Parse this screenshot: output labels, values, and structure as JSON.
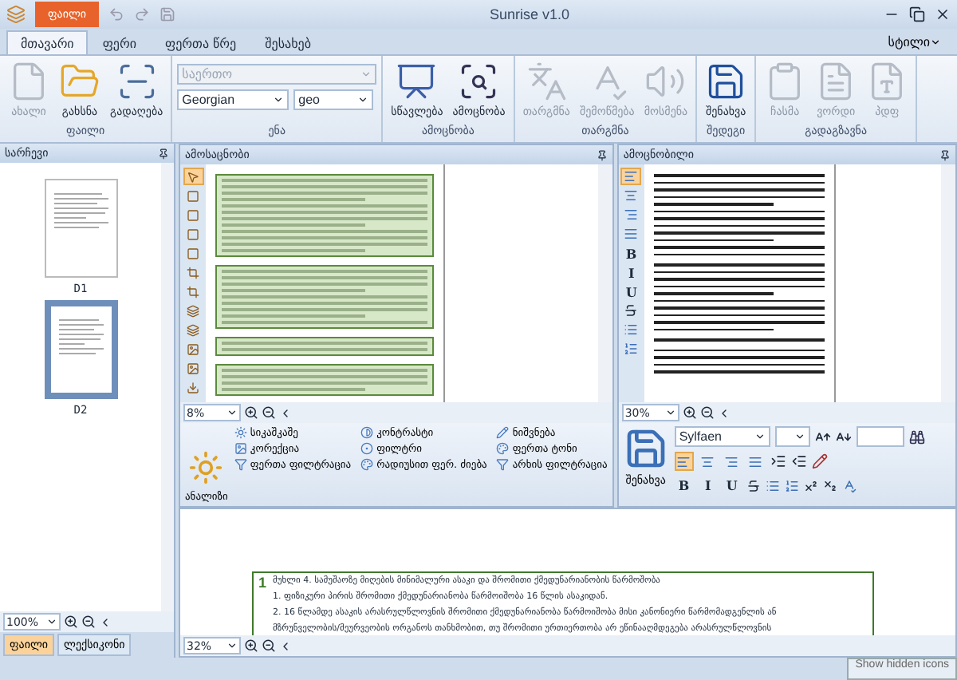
{
  "window": {
    "title": "Sunrise v1.0"
  },
  "app_button": "ფაილი",
  "tabs": [
    {
      "label": "მთავარი",
      "selected": true
    },
    {
      "label": "ფერი",
      "selected": false
    },
    {
      "label": "ფერთა წრე",
      "selected": false
    },
    {
      "label": "შესახებ",
      "selected": false
    }
  ],
  "style_menu": "სტილი",
  "ribbon_groups": [
    {
      "kind": "buttons",
      "label": "ფაილი",
      "items": [
        {
          "label": "ახალი",
          "disabled": true
        },
        {
          "label": "გახსნა",
          "disabled": false
        },
        {
          "label": "გადაღება",
          "disabled": false
        }
      ]
    },
    {
      "kind": "language",
      "label": "ენა",
      "mode": {
        "value": "საერთო",
        "disabled": true
      },
      "language": "Georgian",
      "code": "geo"
    },
    {
      "kind": "buttons",
      "label": "ამოცნობა",
      "items": [
        {
          "label": "სწავლება",
          "disabled": false
        },
        {
          "label": "ამოცნობა",
          "disabled": false
        }
      ]
    },
    {
      "kind": "buttons",
      "label": "თარგმნა",
      "items": [
        {
          "label": "თარგმნა",
          "disabled": true
        },
        {
          "label": "შემოწმება",
          "disabled": true
        },
        {
          "label": "მოსმენა",
          "disabled": true
        }
      ]
    },
    {
      "kind": "buttons",
      "label": "შედეგი",
      "items": [
        {
          "label": "შენახვა",
          "disabled": false
        }
      ]
    },
    {
      "kind": "buttons",
      "label": "გადაგზავნა",
      "items": [
        {
          "label": "ჩასმა",
          "disabled": true
        },
        {
          "label": "ვორდი",
          "disabled": true
        },
        {
          "label": "პდფ",
          "disabled": true
        }
      ]
    }
  ],
  "sidebar": {
    "title": "სარჩევი",
    "pages": [
      {
        "label": "D1",
        "selected": false
      },
      {
        "label": "D2",
        "selected": true
      }
    ],
    "zoom": "100%",
    "tabs": [
      {
        "label": "ფაილი",
        "selected": true
      },
      {
        "label": "ლექსიკონი",
        "selected": false
      }
    ]
  },
  "source_panel": {
    "title": "ამოსაცნობი",
    "zoom": "8%",
    "tools": [
      {
        "selected": true
      },
      {
        "selected": false
      },
      {
        "selected": false
      },
      {
        "selected": false
      },
      {
        "selected": false
      },
      {
        "selected": false
      },
      {
        "selected": false
      },
      {
        "selected": false
      },
      {
        "selected": false
      },
      {
        "selected": false
      },
      {
        "selected": false
      },
      {
        "selected": false
      }
    ]
  },
  "image_tools": {
    "analysis_label": "ანალიზი",
    "items": [
      {
        "label": "სიკაშკაშე"
      },
      {
        "label": "კონტრასტი"
      },
      {
        "label": "ნიშვნება"
      },
      {
        "label": "კორექცია"
      },
      {
        "label": "ფილტრი"
      },
      {
        "label": "ფერთა ტონი"
      },
      {
        "label": "ფერთა ფილტრაცია"
      },
      {
        "label": "რადიუსით ფერ. ძიება"
      },
      {
        "label": "არხის ფილტრაცია"
      }
    ]
  },
  "result_panel": {
    "title": "ამოცნობილი",
    "zoom": "30%",
    "side_align": [
      {
        "selected": true
      },
      {
        "selected": false
      },
      {
        "selected": false
      },
      {
        "selected": false
      }
    ],
    "side_letters": [
      "B",
      "I",
      "U"
    ]
  },
  "format_bar": {
    "save_label": "შენახვა",
    "font": "Sylfaen",
    "alignments": [
      {
        "selected": true
      },
      {
        "selected": false
      },
      {
        "selected": false
      },
      {
        "selected": false
      }
    ],
    "letters": [
      "B",
      "I",
      "U"
    ]
  },
  "document": {
    "block_number": "1",
    "zoom": "32%",
    "lines": [
      "მუხლი 4. სამუშაოზე მიღების მინიმალური ასაკი და შრომითი ქმედუნარიანობის წარმოშობა",
      "1. ფიზიკური პირის შრომითი ქმედუნარიანობა წარმოიშობა 16 წლის ასაკიდან.",
      "2. 16 წლამდე ასაკის არასრულწლოვნის შრომითი ქმედუნარიანობა წარმოიშობა მისი კანონიერი წარმომადგენლის ან",
      "მზრუნველობის/მეურვეობის ორგანოს თანხმობით, თუ შრომითი ურთიერთობა არ ეწინააღმდეგება არასრულწლოვნის"
    ]
  },
  "tooltip": "Show hidden icons"
}
